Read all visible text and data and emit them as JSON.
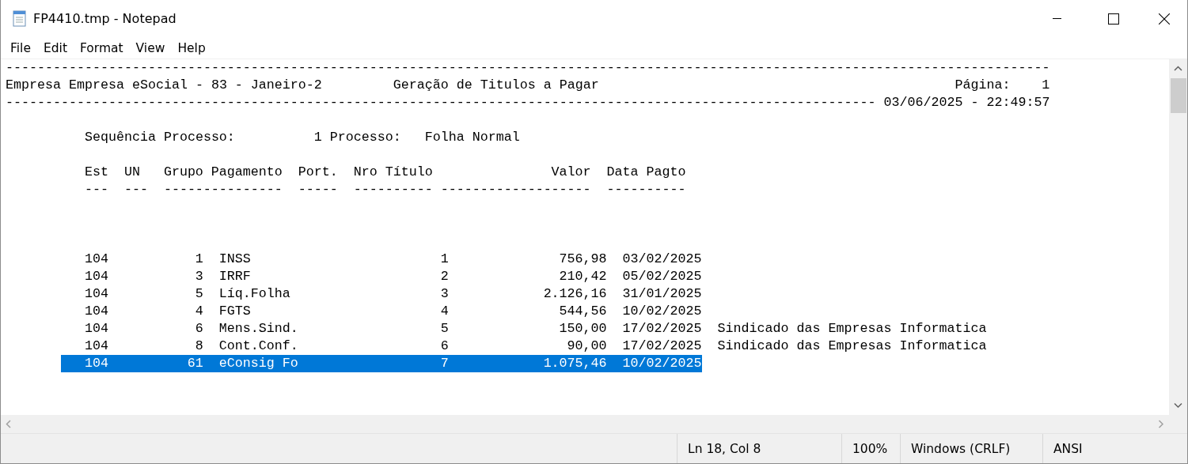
{
  "window": {
    "title": "FP4410.tmp - Notepad"
  },
  "menu": [
    "File",
    "Edit",
    "Format",
    "View",
    "Help"
  ],
  "report": {
    "rule": "------------------------------------------------------------------------------------------------------------------------------------",
    "company": "Empresa Empresa eSocial - 83 - Janeiro-2",
    "title": "Geração de Titulos a Pagar",
    "page_label": "Página:",
    "page": "1",
    "rule_2": "--------------------------------------------------------------------------------------------------------------",
    "timestamp": "03/06/2025 - 22:49:57",
    "sequence_label": "Sequência Processo:",
    "sequence": "1",
    "process_label": "Processo:",
    "process": "Folha Normal",
    "columns": [
      "Est",
      "UN",
      "Grupo Pagamento",
      "Port.",
      "Nro Título",
      "Valor",
      "Data Pagto"
    ],
    "column_rules": [
      "---",
      "---",
      "---------------",
      "-----",
      "----------",
      "-------------------",
      "----------"
    ],
    "rows": [
      {
        "est": "104",
        "grupo": "1",
        "pagamento": "INSS",
        "nro_titulo": "1",
        "valor": "756,98",
        "data_pagto": "03/02/2025",
        "selected": false
      },
      {
        "est": "104",
        "grupo": "3",
        "pagamento": "IRRF",
        "nro_titulo": "2",
        "valor": "210,42",
        "data_pagto": "05/02/2025",
        "selected": false
      },
      {
        "est": "104",
        "grupo": "5",
        "pagamento": "Líq.Folha",
        "nro_titulo": "3",
        "valor": "2.126,16",
        "data_pagto": "31/01/2025",
        "selected": false
      },
      {
        "est": "104",
        "grupo": "4",
        "pagamento": "FGTS",
        "nro_titulo": "4",
        "valor": "544,56",
        "data_pagto": "10/02/2025",
        "selected": false
      },
      {
        "est": "104",
        "grupo": "6",
        "pagamento": "Mens.Sind.",
        "nro_titulo": "5",
        "valor": "150,00",
        "data_pagto": "17/02/2025",
        "column_8": "Sindicado das Empresas Informatica",
        "selected": false
      },
      {
        "est": "104",
        "grupo": "8",
        "pagamento": "Cont.Conf.",
        "nro_titulo": "6",
        "valor": "90,00",
        "data_pagto": "17/02/2025",
        "column_8": "Sindicado das Empresas Informatica",
        "selected": false
      },
      {
        "est": "104",
        "grupo": "61",
        "pagamento": "eConsig Fo",
        "nro_titulo": "7",
        "valor": "1.075,46",
        "data_pagto": "10/02/2025",
        "selected": true
      }
    ]
  },
  "status_bar": {
    "position": "Ln 18, Col 8",
    "zoom": "100%",
    "line_ending": "Windows (CRLF)",
    "encoding": "ANSI"
  }
}
